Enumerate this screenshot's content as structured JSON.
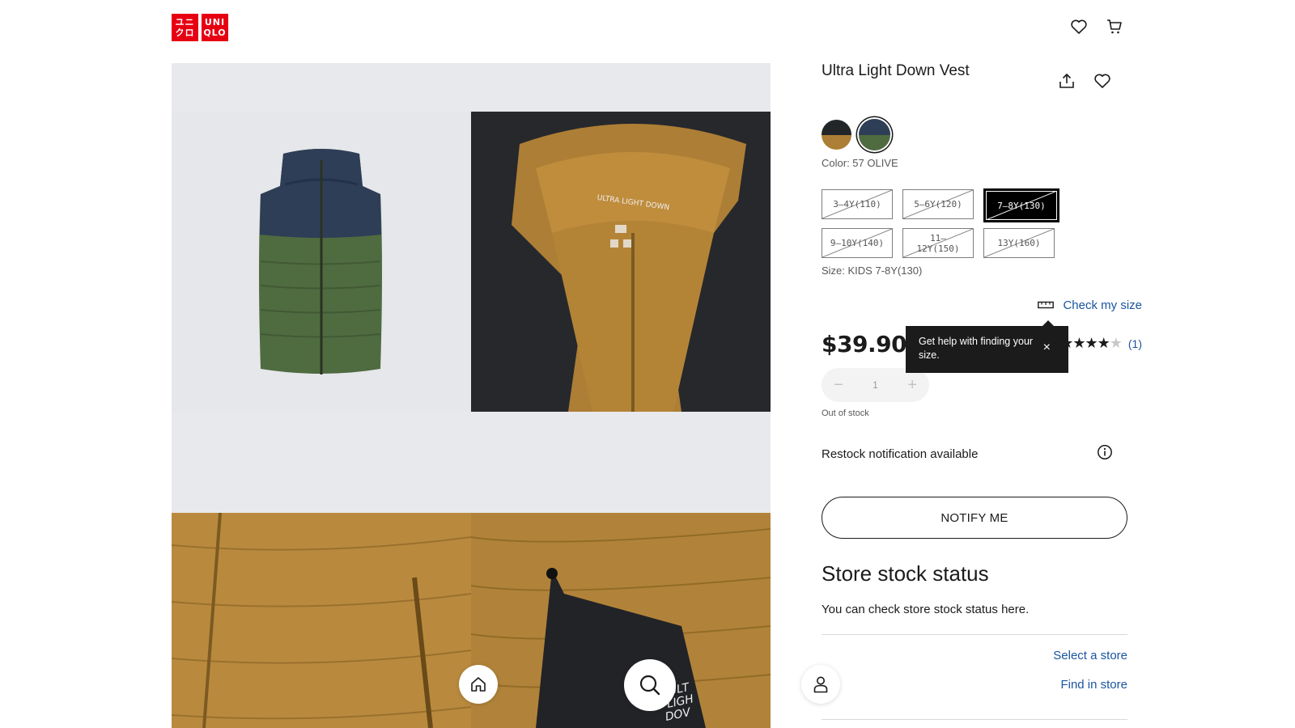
{
  "header": {
    "logo": {
      "box1": [
        "ユニ",
        "クロ"
      ],
      "box2": [
        "UNI",
        "QLO"
      ]
    },
    "icons": [
      "wishlist-heart-icon",
      "cart-icon"
    ]
  },
  "gallery": {
    "images": [
      "vest-front-navy-olive",
      "vest-collar-black-brown",
      "vest-pocket-brown",
      "vest-pouch-brown"
    ],
    "overlay_text": "ULT\nLIGH\nDOW"
  },
  "floating_nav": {
    "icons": [
      "home-icon",
      "search-icon",
      "user-icon"
    ]
  },
  "product": {
    "title": "Ultra Light Down Vest",
    "color_label": "Color: 57 OLIVE",
    "colors": [
      {
        "name": "brown-black",
        "top": "#222629",
        "bottom": "#ad7e35",
        "selected": false
      },
      {
        "name": "olive-navy",
        "top": "#2e3e57",
        "bottom": "#4f6b40",
        "selected": true
      }
    ],
    "sizes": [
      {
        "label": "3–4Y(110)",
        "selected": false
      },
      {
        "label": "5–6Y(120)",
        "selected": false
      },
      {
        "label": "7–8Y(130)",
        "selected": true
      },
      {
        "label": "9–10Y(140)",
        "selected": false
      },
      {
        "label": "11–12Y(150)",
        "selected": false
      },
      {
        "label": "13Y(160)",
        "selected": false
      }
    ],
    "size_label": "Size: KIDS 7-8Y(130)",
    "check_size": "Check my size",
    "price": "$39.90",
    "rating": {
      "stars": 4,
      "max": 5,
      "count": "(1)"
    },
    "tooltip": {
      "text": "Get help with finding your size.",
      "close": "×"
    },
    "quantity": {
      "value": "1",
      "minus": "−",
      "plus": "+"
    },
    "stock_status": "Out of stock",
    "restock": "Restock notification available",
    "notify_button": "NOTIFY ME"
  },
  "store": {
    "title": "Store stock status",
    "description": "You can check store stock status here.",
    "select_store": "Select a store",
    "find_in_store": "Find in store"
  },
  "colors": {
    "brand": "#e60012",
    "link": "#1a55a0",
    "text": "#1b1b1b"
  }
}
